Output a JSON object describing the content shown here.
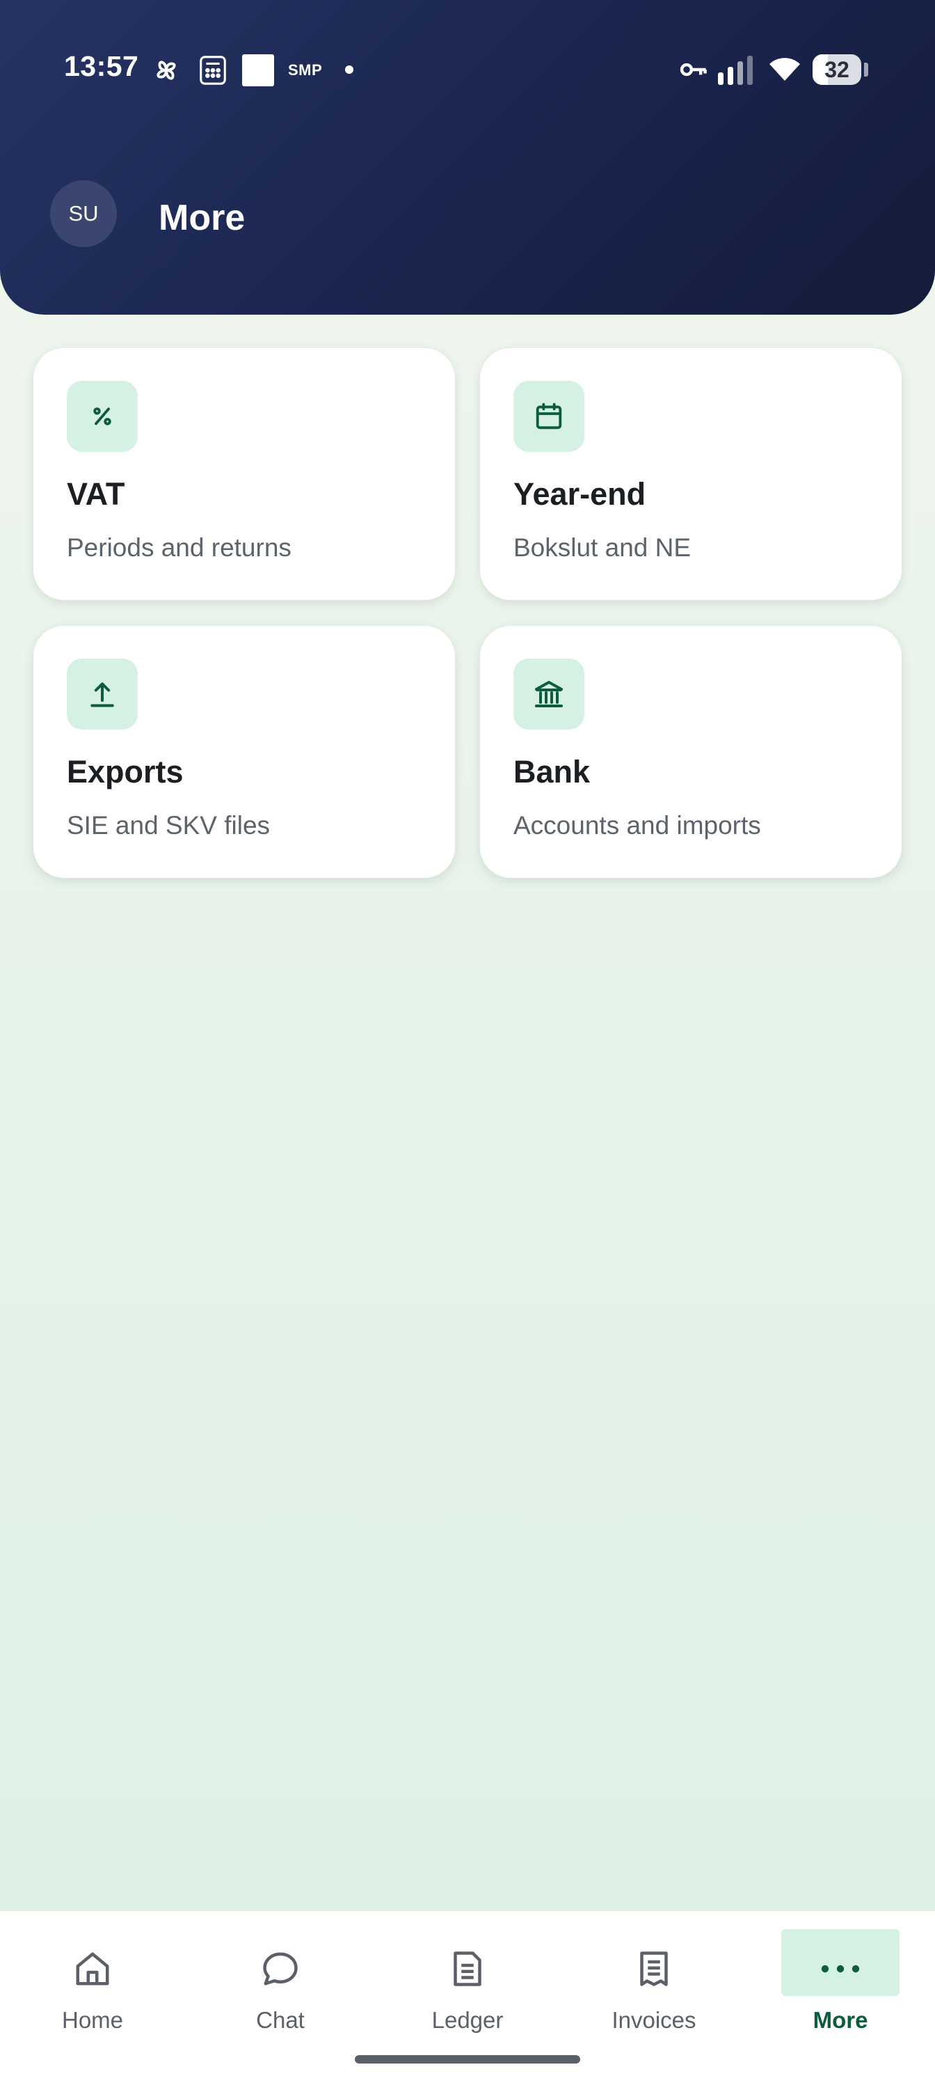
{
  "status_bar": {
    "time": "13:57",
    "carrier_label": "SMP",
    "battery_level": "32",
    "icons": [
      "pinwheel-icon",
      "calculator-icon",
      "square-notification-icon",
      "dot-icon",
      "vpn-key-icon",
      "signal-icon",
      "wifi-icon",
      "battery-icon"
    ]
  },
  "header": {
    "avatar_initials": "SU",
    "title": "More"
  },
  "cards": [
    {
      "title": "VAT",
      "subtitle": "Periods and returns",
      "icon": "percent-icon"
    },
    {
      "title": "Year-end",
      "subtitle": "Bokslut and NE",
      "icon": "calendar-icon"
    },
    {
      "title": "Exports",
      "subtitle": "SIE and SKV files",
      "icon": "upload-icon"
    },
    {
      "title": "Bank",
      "subtitle": "Accounts and imports",
      "icon": "bank-icon"
    }
  ],
  "bottom_nav": {
    "items": [
      {
        "label": "Home",
        "icon": "home-icon"
      },
      {
        "label": "Chat",
        "icon": "chat-bubble-icon"
      },
      {
        "label": "Ledger",
        "icon": "document-icon"
      },
      {
        "label": "Invoices",
        "icon": "receipt-icon"
      },
      {
        "label": "More",
        "icon": "more-dots-icon",
        "active": true
      }
    ]
  },
  "colors": {
    "header_bg": "#1b2650",
    "accent": "#0d5d3c",
    "icon_tile_bg": "#d5f1e3",
    "page_bg": "#e7f3ea"
  }
}
